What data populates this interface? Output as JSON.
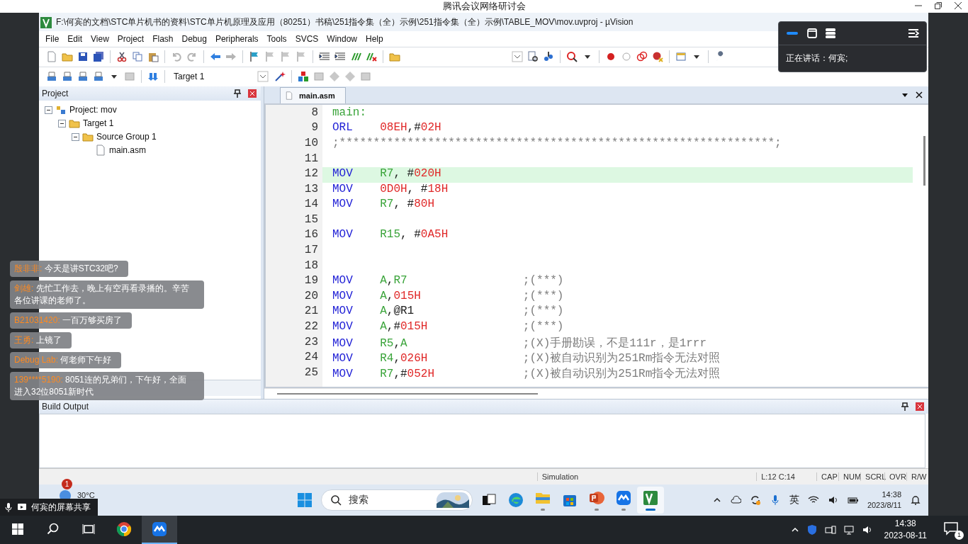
{
  "meeting": {
    "title": "腾讯会议网络研讨会"
  },
  "app": {
    "title": "F:\\何宾的文档\\STC单片机书的资料\\STC单片机原理及应用（80251）书稿\\251指令集（全）示例\\251指令集（全）示例\\TABLE_MOV\\mov.uvproj - µVision",
    "menu": [
      "File",
      "Edit",
      "View",
      "Project",
      "Flash",
      "Debug",
      "Peripherals",
      "Tools",
      "SVCS",
      "Window",
      "Help"
    ],
    "toolbar": {
      "target": "Target 1"
    },
    "project_panel": {
      "title": "Project",
      "tree": [
        {
          "label": "Project: mov",
          "expanded": true,
          "children": [
            {
              "label": "Target 1",
              "expanded": true,
              "children": [
                {
                  "label": "Source Group 1",
                  "expanded": true,
                  "children": [
                    {
                      "label": "main.asm"
                    }
                  ]
                }
              ]
            }
          ]
        }
      ]
    },
    "editor": {
      "tabs": [
        {
          "label": "main.asm",
          "selected": true
        }
      ],
      "lines": [
        {
          "number": "8",
          "current": false,
          "tokens": [
            {
              "kind": "label",
              "text": "main:"
            }
          ]
        },
        {
          "number": "9",
          "current": false,
          "op": "ORL",
          "tokens": [
            {
              "kind": "num",
              "text": "08EH"
            },
            {
              "kind": "punct",
              "text": ",#"
            },
            {
              "kind": "num",
              "text": "02H"
            }
          ]
        },
        {
          "number": "10",
          "current": false,
          "comment": ";****************************************************************;"
        },
        {
          "number": "11",
          "current": false
        },
        {
          "number": "12",
          "current": true,
          "op": "MOV",
          "tokens": [
            {
              "kind": "reg",
              "text": "R7"
            },
            {
              "kind": "punct",
              "text": ", #"
            },
            {
              "kind": "num",
              "text": "020H"
            }
          ]
        },
        {
          "number": "13",
          "current": false,
          "op": "MOV",
          "tokens": [
            {
              "kind": "num",
              "text": "0D0H"
            },
            {
              "kind": "punct",
              "text": ", #"
            },
            {
              "kind": "num",
              "text": "18H"
            }
          ]
        },
        {
          "number": "14",
          "current": false,
          "op": "MOV",
          "tokens": [
            {
              "kind": "reg",
              "text": "R7"
            },
            {
              "kind": "punct",
              "text": ", #"
            },
            {
              "kind": "num",
              "text": "80H"
            }
          ]
        },
        {
          "number": "15",
          "current": false
        },
        {
          "number": "16",
          "current": false,
          "op": "MOV",
          "tokens": [
            {
              "kind": "reg",
              "text": "R15"
            },
            {
              "kind": "punct",
              "text": ", #"
            },
            {
              "kind": "num",
              "text": "0A5H"
            }
          ]
        },
        {
          "number": "17",
          "current": false
        },
        {
          "number": "18",
          "current": false
        },
        {
          "number": "19",
          "current": false,
          "op": "MOV",
          "tokens": [
            {
              "kind": "reg",
              "text": "A"
            },
            {
              "kind": "punct",
              "text": ","
            },
            {
              "kind": "reg",
              "text": "R7"
            }
          ],
          "comment": ";(***)"
        },
        {
          "number": "20",
          "current": false,
          "op": "MOV",
          "tokens": [
            {
              "kind": "reg",
              "text": "A"
            },
            {
              "kind": "punct",
              "text": ","
            },
            {
              "kind": "num",
              "text": "015H"
            }
          ],
          "comment": ";(***)"
        },
        {
          "number": "21",
          "current": false,
          "op": "MOV",
          "tokens": [
            {
              "kind": "reg",
              "text": "A"
            },
            {
              "kind": "punct",
              "text": ",@R1"
            }
          ],
          "comment": ";(***)"
        },
        {
          "number": "22",
          "current": false,
          "op": "MOV",
          "tokens": [
            {
              "kind": "reg",
              "text": "A"
            },
            {
              "kind": "punct",
              "text": ",#"
            },
            {
              "kind": "num",
              "text": "015H"
            }
          ],
          "comment": ";(***)"
        },
        {
          "number": "23",
          "current": false,
          "op": "MOV",
          "tokens": [
            {
              "kind": "reg",
              "text": "R5"
            },
            {
              "kind": "punct",
              "text": ","
            },
            {
              "kind": "reg",
              "text": "A"
            }
          ],
          "comment": ";(X)手册勘误，不是111r，是1rrr"
        },
        {
          "number": "24",
          "current": false,
          "op": "MOV",
          "tokens": [
            {
              "kind": "reg",
              "text": "R4"
            },
            {
              "kind": "punct",
              "text": ","
            },
            {
              "kind": "num",
              "text": "026H"
            }
          ],
          "comment": ";(X)被自动识别为251Rm指令无法对照"
        },
        {
          "number": "25",
          "current": false,
          "op": "MOV",
          "tokens": [
            {
              "kind": "reg",
              "text": "R7"
            },
            {
              "kind": "punct",
              "text": ",#"
            },
            {
              "kind": "num",
              "text": "052H"
            }
          ],
          "comment": ";(X)被自动识别为251Rm指令无法对照"
        }
      ]
    },
    "build_output": {
      "title": "Build Output"
    },
    "status_bar": {
      "mode": "Simulation",
      "position": "L:12 C:14",
      "indicators": [
        "CAP",
        "NUM",
        "SCRL",
        "OVR",
        "R/W"
      ]
    }
  },
  "inner_taskbar": {
    "weather": {
      "badge": "1",
      "temperature": "30°C"
    },
    "search": {
      "placeholder": "搜索"
    },
    "apps": [
      {
        "kind": "start",
        "running": false,
        "selected": false
      },
      {
        "kind": "taskview",
        "running": false,
        "selected": false
      },
      {
        "kind": "edge",
        "running": false,
        "selected": false
      },
      {
        "kind": "files",
        "running": true,
        "selected": false
      },
      {
        "kind": "store",
        "running": false,
        "selected": false
      },
      {
        "kind": "slides",
        "running": true,
        "selected": false
      },
      {
        "kind": "meeting",
        "running": true,
        "selected": false
      },
      {
        "kind": "uvision",
        "running": true,
        "selected": true
      }
    ],
    "ime": "英",
    "time": "14:38",
    "date": "2023/8/11"
  },
  "speaker_panel": {
    "text": "正在讲话：何宾;"
  },
  "chat": [
    {
      "name": "殷非非:",
      "text": "今天是讲STC32吧?"
    },
    {
      "name": "剑雄:",
      "text": "先忙工作去，晚上有空再看录播的。辛苦各位讲课的老师了。"
    },
    {
      "name": "B21031420:",
      "text": "一百万够买房了"
    },
    {
      "name": "王勇:",
      "text": "上镜了"
    },
    {
      "name": "Debug Lab:",
      "text": "何老师下午好"
    },
    {
      "name": "139****5190:",
      "text": "8051连的兄弟们，下午好，全面进入32位8051新时代"
    }
  ],
  "screen_share": {
    "label": "何宾的屏幕共享"
  },
  "host_taskbar": {
    "apps": [
      {
        "kind": "start",
        "selected": false
      },
      {
        "kind": "search",
        "selected": false
      },
      {
        "kind": "taskview",
        "selected": false
      },
      {
        "kind": "chrome",
        "selected": false
      },
      {
        "kind": "meeting",
        "selected": true
      }
    ],
    "time": "14:38",
    "date": "2023-08-11",
    "notifications": "1"
  }
}
